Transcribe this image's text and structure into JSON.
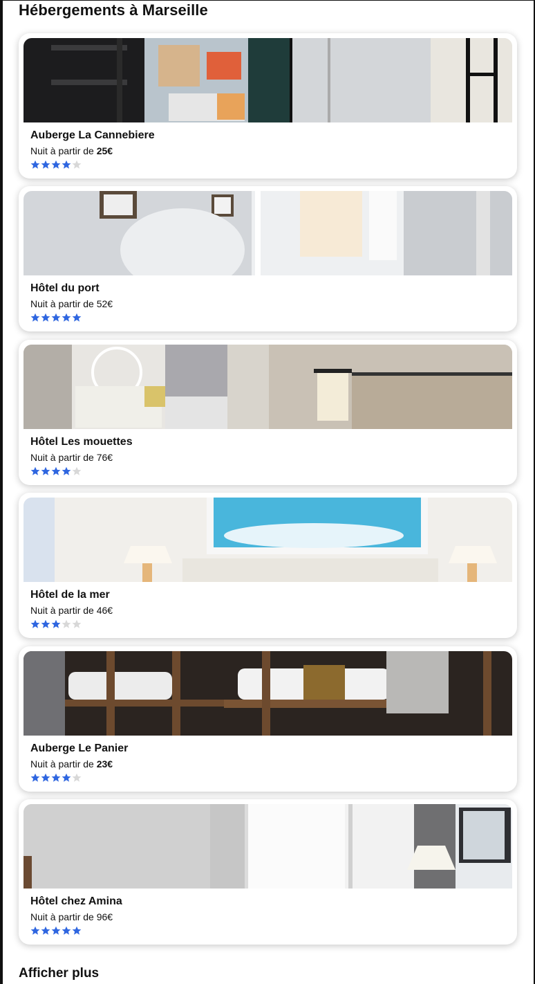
{
  "page": {
    "title": "Hébergements à Marseille"
  },
  "colors": {
    "star_on": "#2f66e0",
    "star_off": "#d8d8d8"
  },
  "listings": [
    {
      "name": "Auberge La Cannebiere",
      "price_prefix": "Nuit à partir de ",
      "price": "25€",
      "price_bold": true,
      "rating": 4,
      "photo": "hostel-dorm-window"
    },
    {
      "name": "Hôtel du port",
      "price_prefix": "Nuit à partir de ",
      "price": "52€",
      "price_bold": false,
      "rating": 5,
      "photo": "bright-room-window"
    },
    {
      "name": "Hôtel Les mouettes",
      "price_prefix": "Nuit à partir de ",
      "price": "76€",
      "price_bold": false,
      "rating": 4,
      "photo": "room-lamp-headboard"
    },
    {
      "name": "Hôtel de la mer",
      "price_prefix": "Nuit à partir de ",
      "price": "46€",
      "price_bold": false,
      "rating": 3,
      "photo": "room-sea-painting"
    },
    {
      "name": "Auberge Le Panier",
      "price_prefix": "Nuit à partir de ",
      "price": "23€",
      "price_bold": true,
      "rating": 4,
      "photo": "wooden-bunk-beds"
    },
    {
      "name": "Hôtel chez Amina",
      "price_prefix": "Nuit à partir de ",
      "price": "96€",
      "price_bold": false,
      "rating": 5,
      "photo": "white-room-curtains"
    }
  ],
  "footer": {
    "more_label": "Afficher plus"
  }
}
